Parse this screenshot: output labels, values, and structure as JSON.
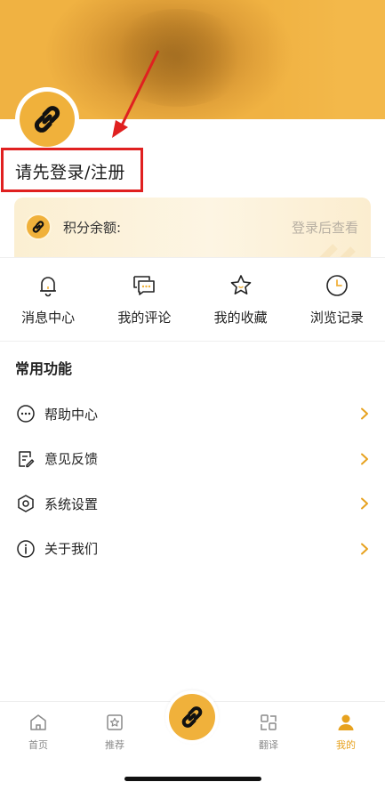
{
  "header": {
    "login_prompt": "请先登录/注册"
  },
  "points": {
    "label": "积分余额:",
    "action": "登录后查看"
  },
  "quick_actions": [
    {
      "label": "消息中心",
      "icon": "bell-icon"
    },
    {
      "label": "我的评论",
      "icon": "comment-icon"
    },
    {
      "label": "我的收藏",
      "icon": "star-icon"
    },
    {
      "label": "浏览记录",
      "icon": "clock-icon"
    }
  ],
  "section": {
    "title": "常用功能"
  },
  "menu": [
    {
      "label": "帮助中心",
      "icon": "help-icon"
    },
    {
      "label": "意见反馈",
      "icon": "feedback-icon"
    },
    {
      "label": "系统设置",
      "icon": "settings-icon"
    },
    {
      "label": "关于我们",
      "icon": "info-icon"
    }
  ],
  "tabbar": [
    {
      "label": "首页",
      "icon": "home-icon"
    },
    {
      "label": "推荐",
      "icon": "recommend-icon"
    },
    {
      "label": "翻译",
      "icon": "translate-icon"
    },
    {
      "label": "我的",
      "icon": "profile-icon"
    }
  ],
  "colors": {
    "accent": "#f0b13b",
    "active_tab": "#e7a21f",
    "annotation": "#e02020"
  }
}
